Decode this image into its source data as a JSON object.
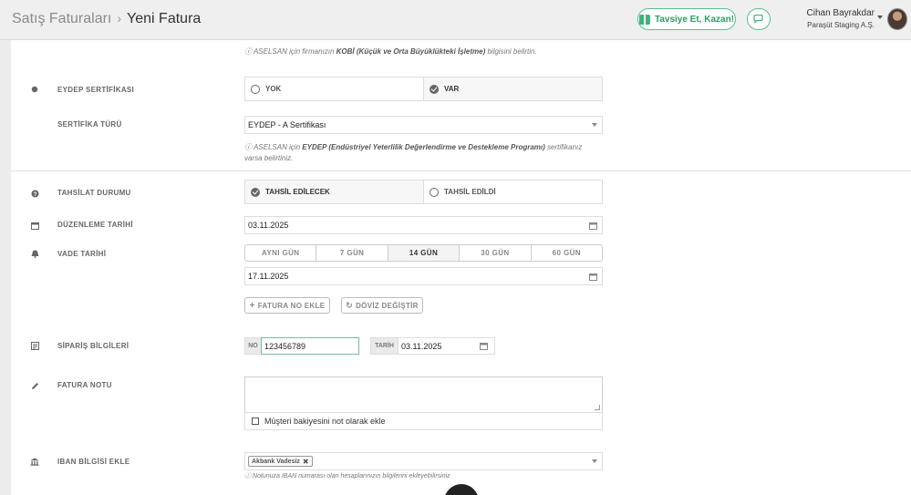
{
  "header": {
    "breadcrumb_parent": "Satış Faturaları",
    "breadcrumb_sep": "›",
    "breadcrumb_current": "Yeni Fatura",
    "invite_label": "Tavsiye Et, Kazan!",
    "user_name": "Cihan Bayrakdar",
    "company_name": "Paraşüt Staging A.Ş.",
    "accent_color": "#3fb37a"
  },
  "kobi_help": {
    "prefix": "ASELSAN için firmanızın ",
    "bold": "KOBİ (Küçük ve Orta Büyüklükteki İşletme)",
    "suffix": " bilgisini belirtin."
  },
  "eydep": {
    "label": "EYDEP SERTİFİKASI",
    "options": [
      "YOK",
      "VAR"
    ],
    "selected": "VAR"
  },
  "cert_type": {
    "label": "SERTİFİKA TÜRÜ",
    "value": "EYDEP - A Sertifikası",
    "help_prefix": "ASELSAN için ",
    "help_bold": "EYDEP (Endüstriyel Yeterlilik Değerlendirme ve Destekleme Programı)",
    "help_suffix": " sertifikanız",
    "help_line2": "varsa belirtiniz."
  },
  "collection": {
    "label": "TAHSİLAT DURUMU",
    "options": [
      "TAHSİL EDİLECEK",
      "TAHSİL EDİLDİ"
    ],
    "selected": "TAHSİL EDİLECEK"
  },
  "issue_date": {
    "label": "DÜZENLEME TARİHİ",
    "value": "03.11.2025"
  },
  "due_date": {
    "label": "VADE TARİHİ",
    "options": [
      "AYNI GÜN",
      "7 GÜN",
      "14 GÜN",
      "30 GÜN",
      "60 GÜN"
    ],
    "selected": "14 GÜN",
    "value": "17.11.2025"
  },
  "buttons": {
    "add_invoice_no": "FATURA NO EKLE",
    "change_currency": "DÖVİZ DEĞİŞTİR"
  },
  "order": {
    "label": "SİPARİŞ BİLGİLERİ",
    "no_prefix": "NO",
    "no_value": "123456789",
    "date_prefix": "TARİH",
    "date_value": "03.11.2025"
  },
  "note": {
    "label": "FATURA NOTU",
    "value": "",
    "checkbox_label": "Müşteri bakiyesini not olarak ekle",
    "checkbox_checked": false
  },
  "iban": {
    "label": "IBAN BİLGİSİ EKLE",
    "tag": "Akbank Vadesiz",
    "help": "Notunuza IBAN numarası olan hesaplarınızın bilgilerini ekleyebilirsiniz"
  }
}
